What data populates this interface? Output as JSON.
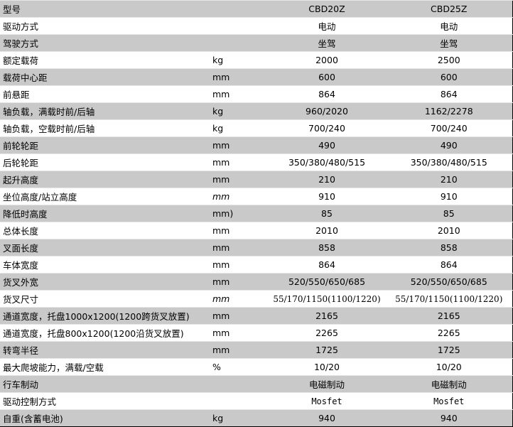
{
  "table": {
    "rows": [
      {
        "param": "型号",
        "unit": "",
        "a": "CBD20Z",
        "b": "CBD25Z"
      },
      {
        "param": "驱动方式",
        "unit": "",
        "a": "电动",
        "b": "电动"
      },
      {
        "param": "驾驶方式",
        "unit": "",
        "a": "坐驾",
        "b": "坐驾"
      },
      {
        "param": "额定载荷",
        "unit": "kg",
        "a": "2000",
        "b": "2500"
      },
      {
        "param": "载荷中心距",
        "unit": "mm",
        "a": "600",
        "b": "600"
      },
      {
        "param": "前悬距",
        "unit": "mm",
        "a": "864",
        "b": "864"
      },
      {
        "param": "轴负载，满载时前/后轴",
        "unit": "kg",
        "a": "960/2020",
        "b": "1162/2278"
      },
      {
        "param": "轴负载，空载时前/后轴",
        "unit": "kg",
        "a": "700/240",
        "b": "700/240"
      },
      {
        "param": "前轮轮距",
        "unit": "mm",
        "a": "490",
        "b": "490"
      },
      {
        "param": "后轮轮距",
        "unit": "mm",
        "a": "350/380/480/515",
        "b": "350/380/480/515"
      },
      {
        "param": "起升高度",
        "unit": "mm",
        "a": "210",
        "b": "210"
      },
      {
        "param": "坐位高度/站立高度",
        "unit": "mm",
        "a": "910",
        "b": "910"
      },
      {
        "param": "降低时高度",
        "unit": "mm)",
        "a": "85",
        "b": "85"
      },
      {
        "param": "总体长度",
        "unit": "mm",
        "a": "2010",
        "b": "2010"
      },
      {
        "param": "叉面长度",
        "unit": "mm",
        "a": "858",
        "b": "858"
      },
      {
        "param": "车体宽度",
        "unit": "mm",
        "a": "864",
        "b": "864"
      },
      {
        "param": "货叉外宽",
        "unit": "mm",
        "a": "520/550/650/685",
        "b": "520/550/650/685"
      },
      {
        "param": "货叉尺寸",
        "unit": "mm",
        "a": "55/170/1150(1100/1220)",
        "b": "55/170/1150(1100/1220)"
      },
      {
        "param": "通道宽度，托盘1000x1200(1200跨货叉放置)",
        "unit": "mm",
        "a": "2165",
        "b": "2165"
      },
      {
        "param": "通道宽度，托盘800x1200(1200沿货叉放置)",
        "unit": "mm",
        "a": "2265",
        "b": "2265"
      },
      {
        "param": "转弯半径",
        "unit": "mm",
        "a": "1725",
        "b": "1725"
      },
      {
        "param": "最大爬坡能力，满载/空载",
        "unit": "%",
        "a": "10/20",
        "b": "10/20"
      },
      {
        "param": "行车制动",
        "unit": "",
        "a": "电磁制动",
        "b": "电磁制动"
      },
      {
        "param": "驱动控制方式",
        "unit": "",
        "a": "Mosfet",
        "b": "Mosfet"
      },
      {
        "param": "自重(含蓄电池)",
        "unit": "kg",
        "a": "940",
        "b": "940"
      }
    ]
  }
}
